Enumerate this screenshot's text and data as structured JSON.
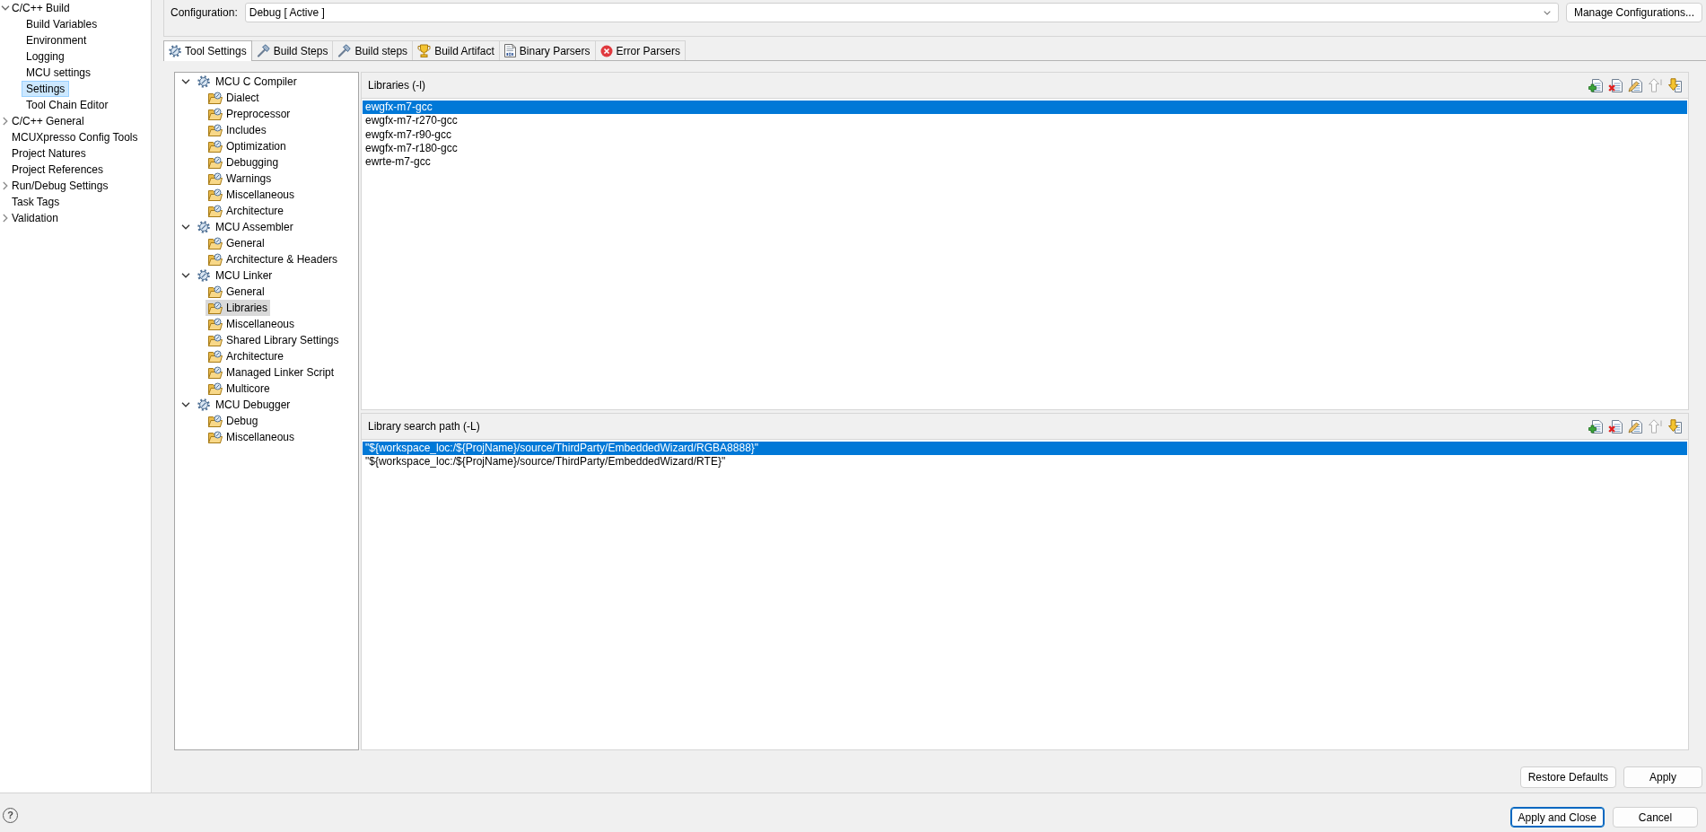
{
  "sidebar": {
    "items": [
      {
        "label": "C/C++ Build",
        "expanded": true,
        "selected": false,
        "children": [
          {
            "label": "Build Variables",
            "selected": false
          },
          {
            "label": "Environment",
            "selected": false
          },
          {
            "label": "Logging",
            "selected": false
          },
          {
            "label": "MCU settings",
            "selected": false
          },
          {
            "label": "Settings",
            "selected": true
          },
          {
            "label": "Tool Chain Editor",
            "selected": false
          }
        ]
      },
      {
        "label": "C/C++ General",
        "expanded": false,
        "selected": false
      },
      {
        "label": "MCUXpresso Config Tools",
        "selected": false
      },
      {
        "label": "Project Natures",
        "selected": false
      },
      {
        "label": "Project References",
        "selected": false
      },
      {
        "label": "Run/Debug Settings",
        "expanded": false,
        "selected": false
      },
      {
        "label": "Task Tags",
        "selected": false
      },
      {
        "label": "Validation",
        "expanded": false,
        "selected": false
      }
    ]
  },
  "configuration": {
    "label": "Configuration:",
    "value": "Debug [ Active ]",
    "button": "Manage Configurations..."
  },
  "tabs": [
    {
      "label": "Tool Settings",
      "kind": "tool",
      "selected": true
    },
    {
      "label": "Build Steps",
      "kind": "build",
      "selected": false
    },
    {
      "label": "Build steps",
      "kind": "build",
      "selected": false
    },
    {
      "label": "Build Artifact",
      "kind": "artifact",
      "selected": false
    },
    {
      "label": "Binary Parsers",
      "kind": "binary",
      "selected": false
    },
    {
      "label": "Error Parsers",
      "kind": "error",
      "selected": false
    }
  ],
  "tool_tree": [
    {
      "label": "MCU C Compiler",
      "expanded": true,
      "selected": false,
      "children": [
        {
          "label": "Dialect",
          "selected": false
        },
        {
          "label": "Preprocessor",
          "selected": false
        },
        {
          "label": "Includes",
          "selected": false
        },
        {
          "label": "Optimization",
          "selected": false
        },
        {
          "label": "Debugging",
          "selected": false
        },
        {
          "label": "Warnings",
          "selected": false
        },
        {
          "label": "Miscellaneous",
          "selected": false
        },
        {
          "label": "Architecture",
          "selected": false
        }
      ]
    },
    {
      "label": "MCU Assembler",
      "expanded": true,
      "selected": false,
      "children": [
        {
          "label": "General",
          "selected": false
        },
        {
          "label": "Architecture & Headers",
          "selected": false
        }
      ]
    },
    {
      "label": "MCU Linker",
      "expanded": true,
      "selected": false,
      "children": [
        {
          "label": "General",
          "selected": false
        },
        {
          "label": "Libraries",
          "selected": true
        },
        {
          "label": "Miscellaneous",
          "selected": false
        },
        {
          "label": "Shared Library Settings",
          "selected": false
        },
        {
          "label": "Architecture",
          "selected": false
        },
        {
          "label": "Managed Linker Script",
          "selected": false
        },
        {
          "label": "Multicore",
          "selected": false
        }
      ]
    },
    {
      "label": "MCU Debugger",
      "expanded": true,
      "selected": false,
      "children": [
        {
          "label": "Debug",
          "selected": false
        },
        {
          "label": "Miscellaneous",
          "selected": false
        }
      ]
    }
  ],
  "option_lists": [
    {
      "title": "Libraries (-l)",
      "toolbar": [
        {
          "kind": "add",
          "disabled": false
        },
        {
          "kind": "delete",
          "disabled": false
        },
        {
          "kind": "edit",
          "disabled": false
        },
        {
          "kind": "up",
          "disabled": true
        },
        {
          "kind": "down",
          "disabled": false
        }
      ],
      "items": [
        {
          "text": "ewgfx-m7-gcc",
          "selected": true
        },
        {
          "text": "ewgfx-m7-r270-gcc",
          "selected": false
        },
        {
          "text": "ewgfx-m7-r90-gcc",
          "selected": false
        },
        {
          "text": "ewgfx-m7-r180-gcc",
          "selected": false
        },
        {
          "text": "ewrte-m7-gcc",
          "selected": false
        }
      ]
    },
    {
      "title": "Library search path (-L)",
      "toolbar": [
        {
          "kind": "add",
          "disabled": false
        },
        {
          "kind": "delete",
          "disabled": false
        },
        {
          "kind": "edit",
          "disabled": false
        },
        {
          "kind": "up",
          "disabled": true
        },
        {
          "kind": "down",
          "disabled": false
        }
      ],
      "items": [
        {
          "text": "\"${workspace_loc:/${ProjName}/source/ThirdParty/EmbeddedWizard/RGBA8888}\"",
          "selected": true
        },
        {
          "text": "\"${workspace_loc:/${ProjName}/source/ThirdParty/EmbeddedWizard/RTE}\"",
          "selected": false
        }
      ]
    }
  ],
  "page_buttons": [
    {
      "label": "Restore Defaults"
    },
    {
      "label": "Apply"
    }
  ],
  "help": {
    "symbol": "?"
  },
  "dialog_buttons": [
    {
      "label": "Apply and Close",
      "default": true
    },
    {
      "label": "Cancel",
      "default": false
    }
  ]
}
